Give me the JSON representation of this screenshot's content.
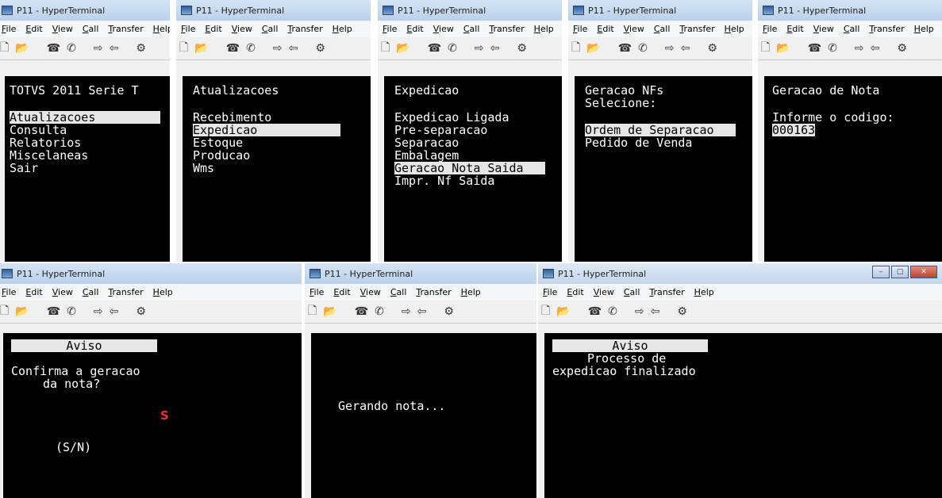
{
  "title": "P11 - HyperTerminal",
  "menu": [
    "File",
    "Edit",
    "View",
    "Call",
    "Transfer",
    "Help"
  ],
  "toolbar_icons": [
    "new-icon",
    "open-icon",
    "disconnect-icon",
    "phone-icon",
    "send-icon",
    "receive-icon",
    "properties-icon"
  ],
  "windows": [
    {
      "lines": [
        "TOTVS 2011 Serie T",
        "Atualizacoes",
        "Consulta",
        "Relatorios",
        "Miscelaneas",
        "Sair"
      ]
    },
    {
      "lines": [
        "Atualizacoes",
        "Recebimento",
        "Expedicao",
        "Estoque",
        "Producao",
        "Wms"
      ]
    },
    {
      "lines": [
        "Expedicao",
        "Expedicao Ligada",
        "Pre-separacao",
        "Separacao",
        "Embalagem",
        "Geracao Nota Saida",
        "Impr. Nf Saida"
      ]
    },
    {
      "lines": [
        "Geracao NFs",
        "Selecione:",
        "Ordem de Separacao",
        "Pedido de Venda"
      ]
    },
    {
      "lines": [
        "Geracao de Nota",
        "Informe o codigo:",
        "000163"
      ]
    },
    {
      "lines": [
        "Aviso",
        "Confirma a geracao",
        "da nota?",
        "S",
        "(S/N)"
      ]
    },
    {
      "lines": [
        "Gerando nota..."
      ]
    },
    {
      "lines": [
        "Aviso",
        "Processo de",
        "expedicao finalizado"
      ]
    }
  ]
}
